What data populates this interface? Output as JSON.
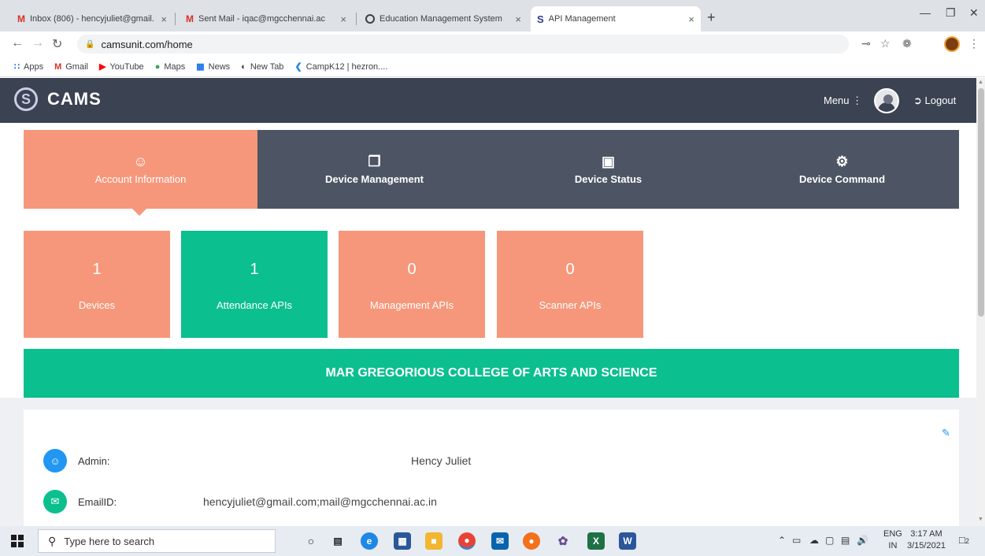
{
  "browser": {
    "tabs": [
      {
        "title": "Inbox (806) - hencyjuliet@gmail.",
        "icon": "gmail-icon"
      },
      {
        "title": "Sent Mail - iqac@mgcchennai.ac",
        "icon": "gmail-icon"
      },
      {
        "title": "Education Management System",
        "icon": "globe-icon"
      },
      {
        "title": "API Management",
        "icon": "cams-icon"
      }
    ],
    "close_glyph": "×",
    "new_tab_glyph": "+",
    "url": "camsunit.com/home",
    "bookmarks": [
      {
        "label": "Apps",
        "icon": "apps-grid-icon"
      },
      {
        "label": "Gmail",
        "icon": "gmail-icon"
      },
      {
        "label": "YouTube",
        "icon": "youtube-icon"
      },
      {
        "label": "Maps",
        "icon": "maps-pin-icon"
      },
      {
        "label": "News",
        "icon": "news-icon"
      },
      {
        "label": "New Tab",
        "icon": "globe-icon"
      },
      {
        "label": "CampK12 | hezron....",
        "icon": "campk12-icon"
      }
    ]
  },
  "app": {
    "logo_text": "CAMS",
    "menu_label": "Menu",
    "logout_label": "Logout",
    "nav_tabs": [
      {
        "label": "Account Information",
        "icon": "user-icon",
        "selected": true
      },
      {
        "label": "Device Management",
        "icon": "copy-device-icon",
        "selected": false
      },
      {
        "label": "Device Status",
        "icon": "image-status-icon",
        "selected": false
      },
      {
        "label": "Device Command",
        "icon": "gear-icon",
        "selected": false
      }
    ],
    "stats": [
      {
        "value": "1",
        "label": "Devices",
        "color": "#f6977b"
      },
      {
        "value": "1",
        "label": "Attendance APIs",
        "color": "#0bbf8f"
      },
      {
        "value": "0",
        "label": "Management APIs",
        "color": "#f6977b"
      },
      {
        "value": "0",
        "label": "Scanner APIs",
        "color": "#f6977b"
      }
    ],
    "organization": "MAR GREGORIOUS COLLEGE OF ARTS AND SCIENCE",
    "account": {
      "admin_label": "Admin:",
      "admin_value": "Hency Juliet",
      "email_label": "EmailID:",
      "email_value": "hencyjuliet@gmail.com;mail@mgcchennai.ac.in"
    },
    "colors": {
      "header": "#3b4251",
      "accent_salmon": "#f6977b",
      "accent_green": "#0bbf8f",
      "info_blue": "#2196f3"
    }
  },
  "taskbar": {
    "search_placeholder": "Type here to search",
    "lang_top": "ENG",
    "lang_bottom": "IN",
    "time": "3:17 AM",
    "date": "3/15/2021",
    "notification_count": "2"
  }
}
